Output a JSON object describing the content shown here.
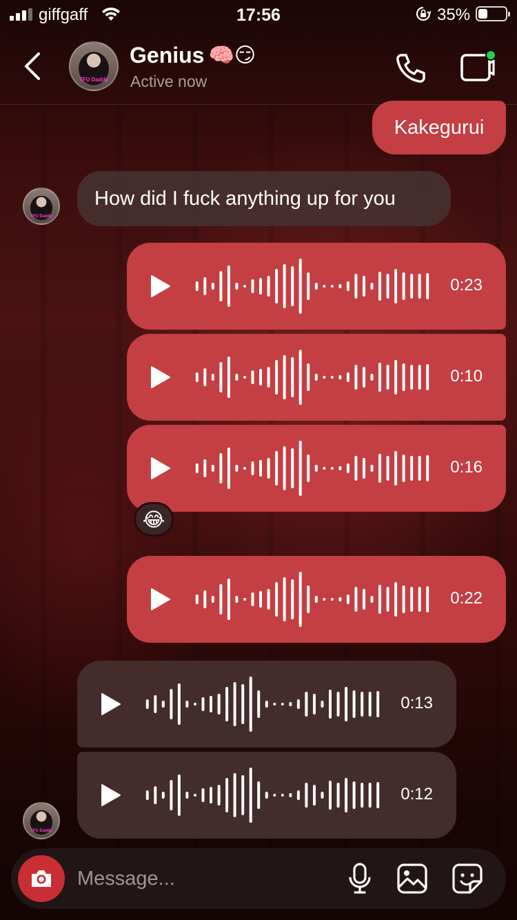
{
  "status_bar": {
    "carrier": "giffgaff",
    "time": "17:56",
    "battery_percent_text": "35%",
    "battery_level": 0.35,
    "icons": [
      "signal-bars-icon",
      "wifi-icon",
      "orientation-lock-icon",
      "battery-icon"
    ]
  },
  "header": {
    "contact_name": "Genius",
    "name_emojis": "🧠😏",
    "presence": "Active now",
    "avatar_tag": "TFU Daddy",
    "icons": [
      "back-chevron-icon",
      "phone-icon",
      "video-camera-icon"
    ],
    "video_status_color": "#22d04a"
  },
  "messages": {
    "outgoing_text": "Kakegurui",
    "incoming_text": "How did I fuck anything up for you",
    "voice_messages": [
      {
        "direction": "outgoing",
        "duration": "0:23"
      },
      {
        "direction": "outgoing",
        "duration": "0:10"
      },
      {
        "direction": "outgoing",
        "duration": "0:16"
      },
      {
        "direction": "outgoing",
        "duration": "0:22"
      },
      {
        "direction": "incoming",
        "duration": "0:13"
      },
      {
        "direction": "incoming",
        "duration": "0:12"
      }
    ],
    "reaction_emoji": "😂"
  },
  "composer": {
    "placeholder": "Message...",
    "icons": [
      "camera-icon",
      "microphone-icon",
      "gallery-icon",
      "sticker-icon"
    ]
  },
  "colors": {
    "outgoing_bubble": "#c43f43",
    "incoming_bubble": "#463030",
    "camera_button": "#c82e33"
  }
}
